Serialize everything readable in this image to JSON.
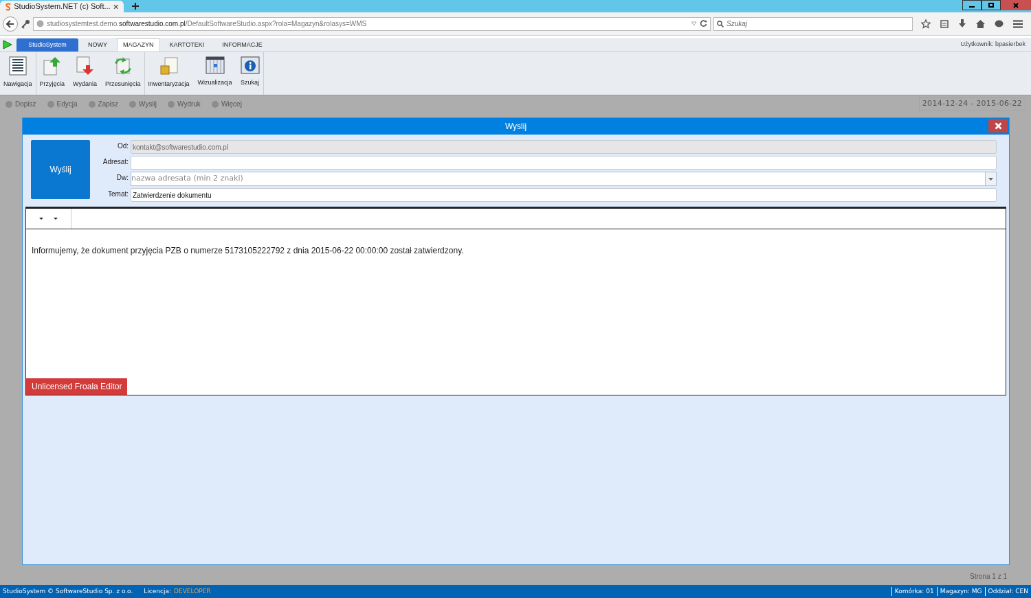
{
  "browser": {
    "tab_title": "StudioSystem.NET (c) Soft...",
    "url": "studiosystemtest.demo.**softwarestudio.com.pl**/DefaultSoftwareStudio.aspx?rola=Magazyn&rolasys=WMS",
    "search_placeholder": "Szukaj"
  },
  "app_tabs": [
    {
      "label": "StudioSystem",
      "kind": "app",
      "selected": false
    },
    {
      "label": "NOWY",
      "kind": "tab",
      "selected": false
    },
    {
      "label": "MAGAZYN",
      "kind": "tab",
      "selected": true
    },
    {
      "label": "KARTOTEKI",
      "kind": "tab",
      "selected": false
    },
    {
      "label": "INFORMACJE",
      "kind": "tab",
      "selected": false
    }
  ],
  "user": "Użytkownik: bpasierbek",
  "ribbon": [
    [
      {
        "label": "Nawigacja",
        "kind": "list"
      }
    ],
    [
      {
        "label": "Przyjęcia",
        "kind": "in"
      },
      {
        "label": "Wydania",
        "kind": "out"
      },
      {
        "label": "Przesunięcia",
        "kind": "move"
      }
    ],
    [
      {
        "label": "Inwentaryzacja",
        "kind": "box"
      },
      {
        "label": "Wizualizacja",
        "kind": "grid"
      },
      {
        "label": "Szukaj",
        "kind": "info"
      }
    ]
  ],
  "background": {
    "toolbar": [
      "Dopisz",
      "Edycja",
      "Zapisz",
      "Wyslij",
      "Wydruk",
      "Więcej"
    ],
    "date_range": "2014-12-24 - 2015-06-22",
    "pager": "Strona 1 z 1"
  },
  "dialog": {
    "title": "Wyslij",
    "send_button": "Wyślij",
    "fields": [
      {
        "label": "Od:",
        "kind": "text",
        "value": "kontakt@softwarestudio.com.pl",
        "disabled": true
      },
      {
        "label": "Adresat:",
        "kind": "text",
        "disabled": false
      },
      {
        "label": "Dw:",
        "kind": "combo",
        "placeholder": "nazwa adresata (min 2 znaki)",
        "disabled": false
      },
      {
        "label": "Temat:",
        "kind": "text",
        "value": "Zatwierdzenie dokumentu",
        "disabled": false
      }
    ],
    "editor_text": "Informujemy, że dokument przyjęcia PZB o numerze 5173105222792 z dnia 2015-06-22 00:00:00 został zatwierdzony.",
    "license_banner": "Unlicensed Froala Editor"
  },
  "status_bar": {
    "copyright": "StudioSystem © SoftwareStudio Sp. z o.o.",
    "license_label": "Licencja:",
    "license_value": "DEVELOPER",
    "items": [
      "Komórka: 01",
      "Magazyn: MG",
      "Oddział: CEN"
    ]
  }
}
